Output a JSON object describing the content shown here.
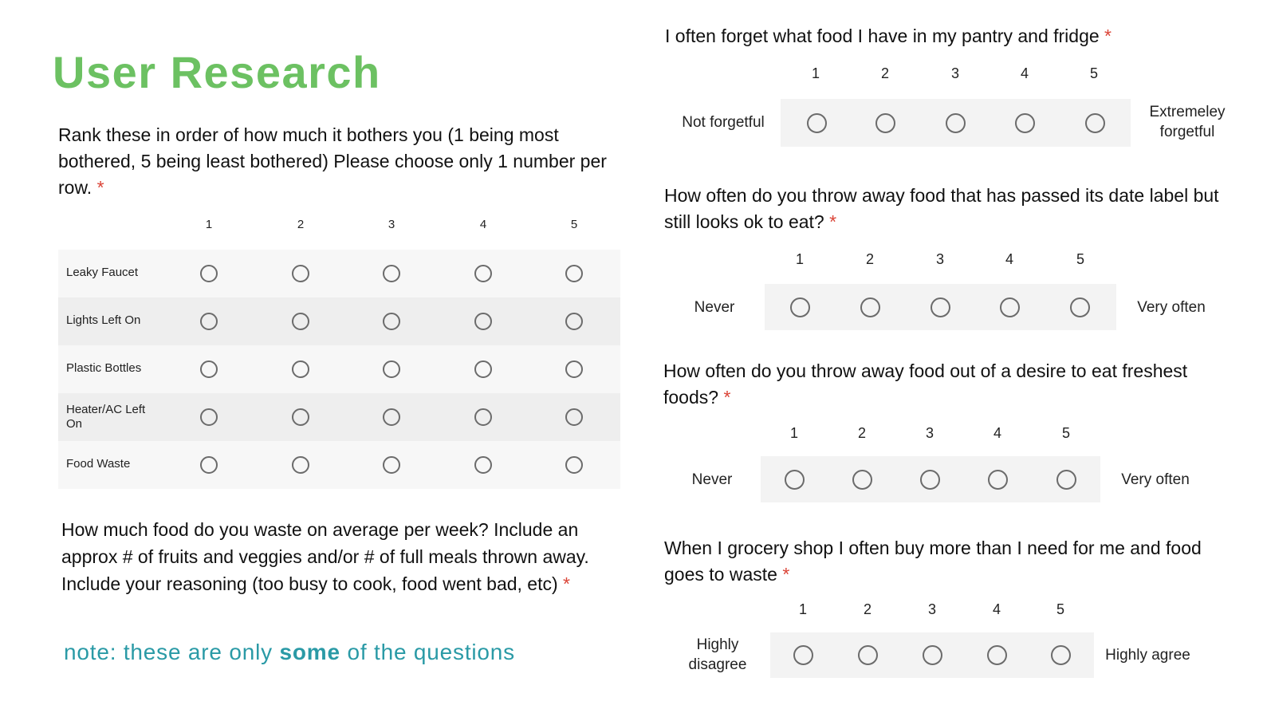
{
  "title": "User Research",
  "rank_question": {
    "text": "Rank these in order of how much it bothers you (1 being most bothered, 5 being least bothered) Please choose only 1 number per row.",
    "required_mark": "*",
    "columns": [
      "1",
      "2",
      "3",
      "4",
      "5"
    ],
    "rows": [
      "Leaky Faucet",
      "Lights Left On",
      "Plastic Bottles",
      "Heater/AC Left On",
      "Food Waste"
    ]
  },
  "waste_question": {
    "text": "How much food do you waste on average per week? Include an approx # of fruits and veggies and/or # of full meals thrown away. Include your reasoning (too busy to cook, food went bad, etc)",
    "required_mark": "*"
  },
  "note": {
    "prefix": "note: these are only ",
    "bold": "some",
    "suffix": " of the questions"
  },
  "scale_questions": [
    {
      "text": "I often forget what food I have in my pantry and fridge",
      "required_mark": "*",
      "scale": [
        "1",
        "2",
        "3",
        "4",
        "5"
      ],
      "low_label": "Not forgetful",
      "high_label": "Extremeley forgetful"
    },
    {
      "text": "How often do you throw away food that has passed its date label but still looks ok to eat?",
      "required_mark": "*",
      "scale": [
        "1",
        "2",
        "3",
        "4",
        "5"
      ],
      "low_label": "Never",
      "high_label": "Very often"
    },
    {
      "text": "How often do you throw away food out of a desire to eat freshest foods?",
      "required_mark": "*",
      "scale": [
        "1",
        "2",
        "3",
        "4",
        "5"
      ],
      "low_label": "Never",
      "high_label": "Very often"
    },
    {
      "text": "When I grocery shop I often buy more than I need for me and food goes to waste",
      "required_mark": "*",
      "scale": [
        "1",
        "2",
        "3",
        "4",
        "5"
      ],
      "low_label": "Highly disagree",
      "high_label": "Highly agree"
    }
  ]
}
